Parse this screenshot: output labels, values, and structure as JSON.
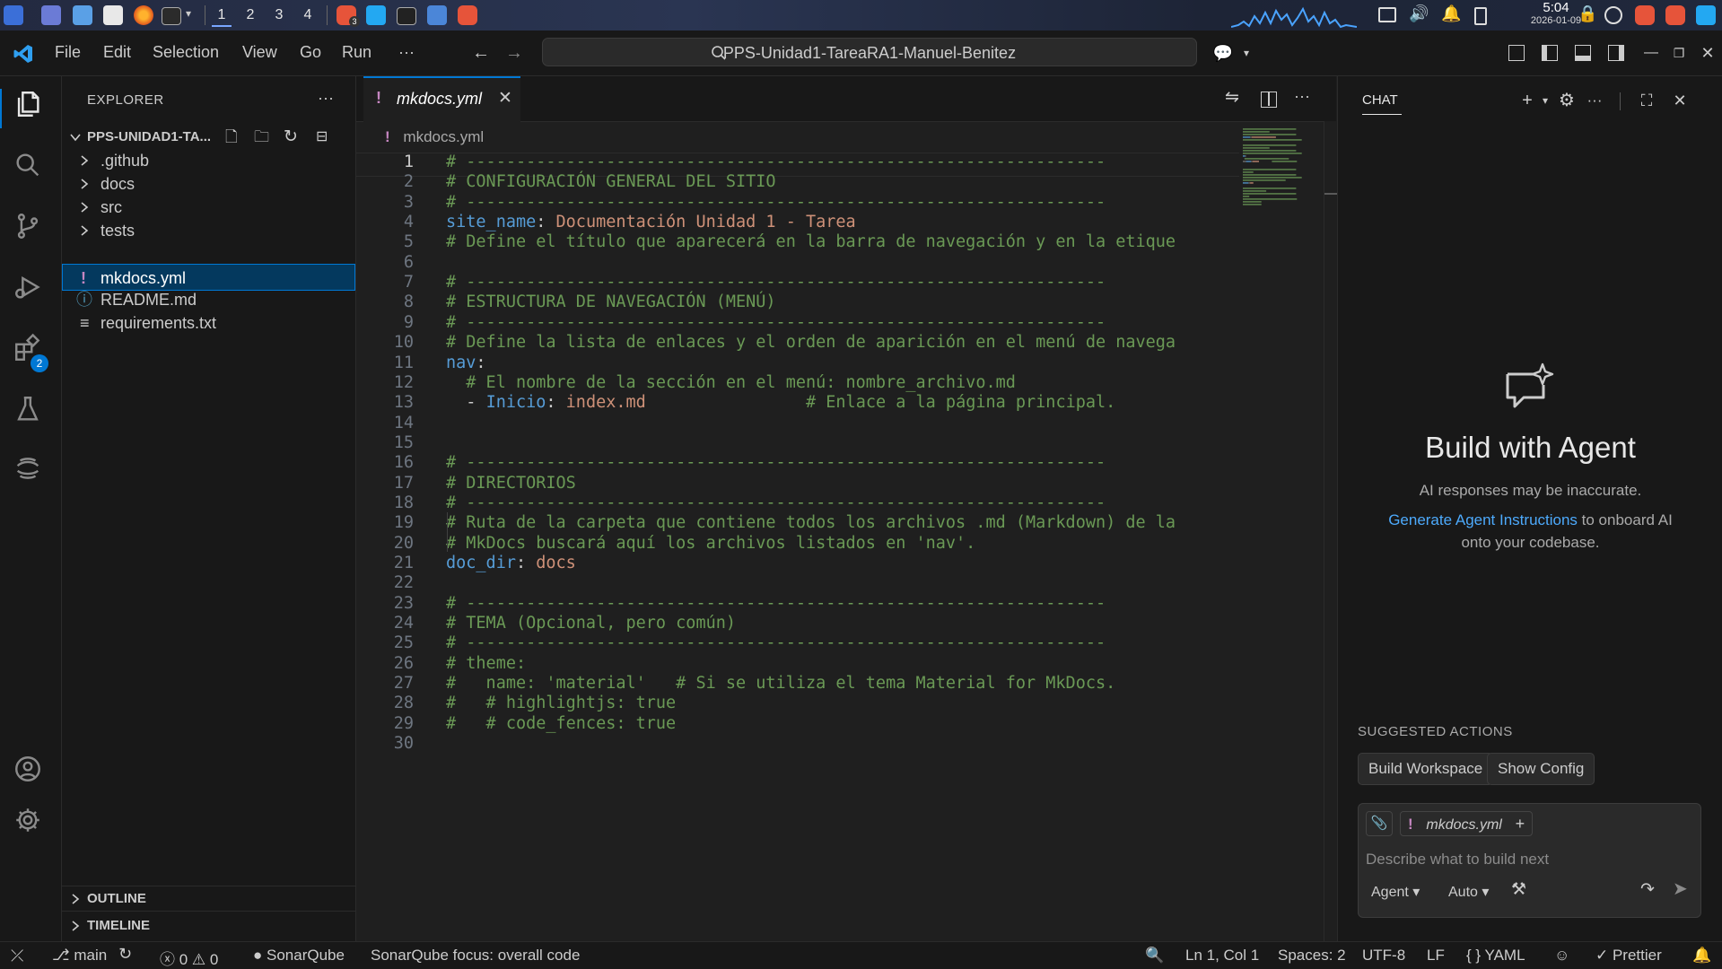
{
  "system": {
    "workspaces": [
      "1",
      "2",
      "3",
      "4"
    ],
    "clock_time": "5:04",
    "clock_date": "2026-01-09",
    "brave_badge": "3"
  },
  "titlebar": {
    "menu": [
      "File",
      "Edit",
      "Selection",
      "View",
      "Go",
      "Run"
    ],
    "more": "···",
    "search_text": "PPS-Unidad1-TareaRA1-Manuel-Benitez"
  },
  "activity": {
    "extensions_badge": "2"
  },
  "explorer": {
    "title": "EXPLORER",
    "more": "···",
    "project": "PPS-UNIDAD1-TA...",
    "folders": [
      ".github",
      "docs",
      "src",
      "tests"
    ],
    "files": [
      {
        "name": "mkdocs.yml",
        "icon": "!"
      },
      {
        "name": "README.md",
        "icon": "ⓘ"
      },
      {
        "name": "requirements.txt",
        "icon": "≡"
      }
    ],
    "outline": "OUTLINE",
    "timeline": "TIMELINE"
  },
  "editor": {
    "tab_label": "mkdocs.yml",
    "tab_icon": "!",
    "breadcrumb": "mkdocs.yml",
    "lines": [
      [
        [
          "c",
          "# ----------------------------------------------------------------"
        ]
      ],
      [
        [
          "c",
          "# CONFIGURACIÓN GENERAL DEL SITIO"
        ]
      ],
      [
        [
          "c",
          "# ----------------------------------------------------------------"
        ]
      ],
      [
        [
          "k",
          "site_name"
        ],
        [
          "p",
          ": "
        ],
        [
          "s",
          "Documentación Unidad 1 - Tarea"
        ]
      ],
      [
        [
          "c",
          "# Define el título que aparecerá en la barra de navegación y en la etique"
        ]
      ],
      [],
      [
        [
          "c",
          "# ----------------------------------------------------------------"
        ]
      ],
      [
        [
          "c",
          "# ESTRUCTURA DE NAVEGACIÓN (MENÚ)"
        ]
      ],
      [
        [
          "c",
          "# ----------------------------------------------------------------"
        ]
      ],
      [
        [
          "c",
          "# Define la lista de enlaces y el orden de aparición en el menú de navega"
        ]
      ],
      [
        [
          "k",
          "nav"
        ],
        [
          "p",
          ":"
        ]
      ],
      [
        [
          "p",
          "  "
        ],
        [
          "c",
          "# El nombre de la sección en el menú: nombre_archivo.md"
        ]
      ],
      [
        [
          "p",
          "  - "
        ],
        [
          "k",
          "Inicio"
        ],
        [
          "p",
          ": "
        ],
        [
          "s",
          "index.md"
        ],
        [
          "p",
          "                "
        ],
        [
          "c",
          "# Enlace a la página principal."
        ]
      ],
      [],
      [],
      [
        [
          "c",
          "# ----------------------------------------------------------------"
        ]
      ],
      [
        [
          "c",
          "# DIRECTORIOS"
        ]
      ],
      [
        [
          "c",
          "# ----------------------------------------------------------------"
        ]
      ],
      [
        [
          "c",
          "# Ruta de la carpeta que contiene todos los archivos .md (Markdown) de la"
        ]
      ],
      [
        [
          "c",
          "# MkDocs buscará aquí los archivos listados en 'nav'."
        ]
      ],
      [
        [
          "k",
          "doc_dir"
        ],
        [
          "p",
          ": "
        ],
        [
          "s",
          "docs"
        ]
      ],
      [],
      [
        [
          "c",
          "# ----------------------------------------------------------------"
        ]
      ],
      [
        [
          "c",
          "# TEMA (Opcional, pero común)"
        ]
      ],
      [
        [
          "c",
          "# ----------------------------------------------------------------"
        ]
      ],
      [
        [
          "c",
          "# theme:"
        ]
      ],
      [
        [
          "c",
          "#   name: 'material'   # Si se utiliza el tema Material for MkDocs."
        ]
      ],
      [
        [
          "c",
          "#   # highlightjs: true"
        ]
      ],
      [
        [
          "c",
          "#   # code_fences: true"
        ]
      ],
      []
    ]
  },
  "chat": {
    "title": "CHAT",
    "heading": "Build with Agent",
    "disclaimer": "AI responses may be inaccurate.",
    "link_text": "Generate Agent Instructions",
    "link_suffix": " to onboard AI",
    "link_suffix2": "onto your codebase.",
    "suggested_title": "SUGGESTED ACTIONS",
    "actions": [
      "Build Workspace",
      "Show Config"
    ],
    "context_file": "mkdocs.yml",
    "placeholder": "Describe what to build next",
    "mode": "Agent",
    "model": "Auto"
  },
  "status": {
    "branch": "main",
    "errors": "0",
    "warnings": "0",
    "sonar": "SonarQube",
    "sonar_focus": "SonarQube focus: overall code",
    "position": "Ln 1, Col 1",
    "spaces": "Spaces: 2",
    "encoding": "UTF-8",
    "eol": "LF",
    "language": "YAML",
    "prettier": "Prettier"
  },
  "colors": {
    "accent": "#0078d4",
    "comment": "#6a9955",
    "key": "#569cd6",
    "string": "#ce9178"
  }
}
